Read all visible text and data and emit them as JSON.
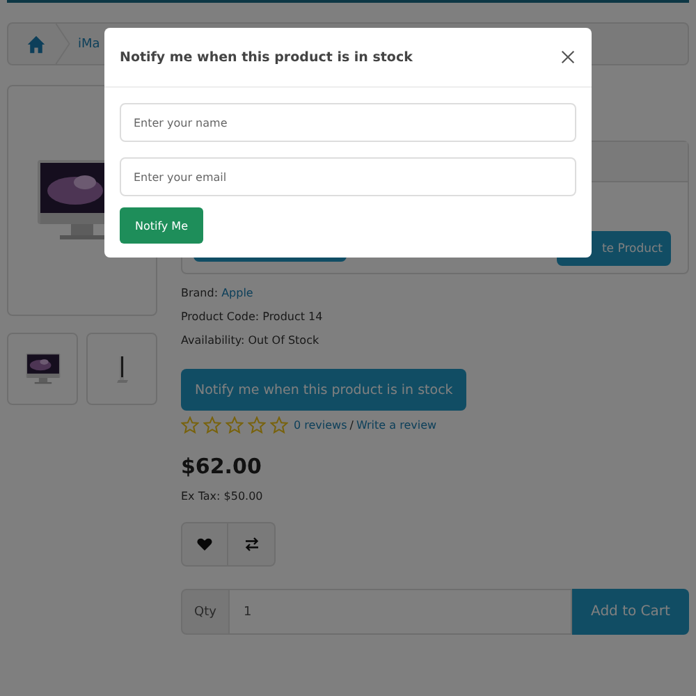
{
  "breadcrumb": {
    "items": [
      "iMa"
    ]
  },
  "product": {
    "compare_button_partial": "te Product",
    "brand_label": "Brand:",
    "brand": "Apple",
    "code": "Product Code: Product 14",
    "availability": "Availability: Out Of Stock",
    "notify_button": "Notify me when this product is in stock",
    "stars": 0,
    "reviews": "0 reviews",
    "separator": "/",
    "write_review": "Write a review",
    "price": "$62.00",
    "ex_tax": "Ex Tax: $50.00",
    "qty_label": "Qty",
    "qty_value": "1",
    "add_to_cart": "Add to Cart"
  },
  "modal": {
    "title": "Notify me when this product is in stock",
    "fields": [
      {
        "placeholder": "Enter your name"
      },
      {
        "placeholder": "Enter your email"
      }
    ],
    "button": "Notify Me"
  }
}
